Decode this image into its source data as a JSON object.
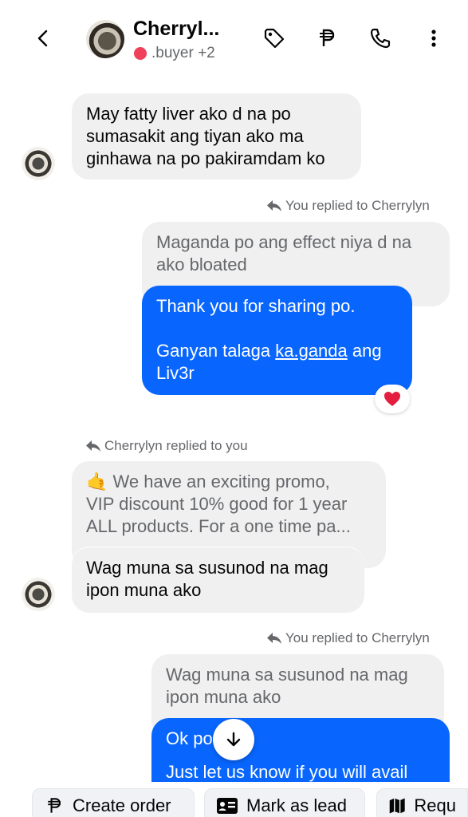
{
  "header": {
    "contact_name": "Cherryl...",
    "contact_tag": ".buyer +2",
    "icons": [
      "back-icon",
      "tag-icon",
      "peso-icon",
      "phone-icon",
      "more-icon"
    ]
  },
  "messages": {
    "m1": {
      "line1": "May fatty liver ako d na po",
      "line2": "sumasakit ang tiyan ako ma",
      "line3": "ginhawa na po pakiramdam ko"
    },
    "reply1_label": "You replied to Cherrylyn",
    "m2_quoted": {
      "line1": "Maganda po ang effect niya d na",
      "line2": "ako bloated"
    },
    "m2_reply": {
      "line1": "Thank you for sharing po.",
      "line2a": "Ganyan talaga ",
      "line2b": "ka.ganda",
      "line2c": " ang",
      "line3": "Liv3r"
    },
    "reaction": "❤️",
    "reply2_label": "Cherrylyn replied to you",
    "m3_quoted": {
      "line1": "🤙 We have an exciting promo,",
      "line2": "VIP discount 10% good for 1 year",
      "line3": "ALL products. For a one time pa..."
    },
    "m3_reply": {
      "line1": "Wag muna sa susunod na mag",
      "line2": "ipon muna ako"
    },
    "reply3_label": "You replied to Cherrylyn",
    "m4_quoted": {
      "line1": "Wag muna sa susunod na mag",
      "line2": "ipon muna ako"
    },
    "m4_reply": {
      "line1": "Ok po",
      "line2": "Just let us know if you will avail"
    }
  },
  "actions": {
    "create_order": "Create order",
    "mark_as_lead": "Mark as lead",
    "request": "Requ"
  },
  "colors": {
    "accent": "#0866ff",
    "incoming": "#f0f0f0",
    "status_dot": "#f0405a"
  }
}
